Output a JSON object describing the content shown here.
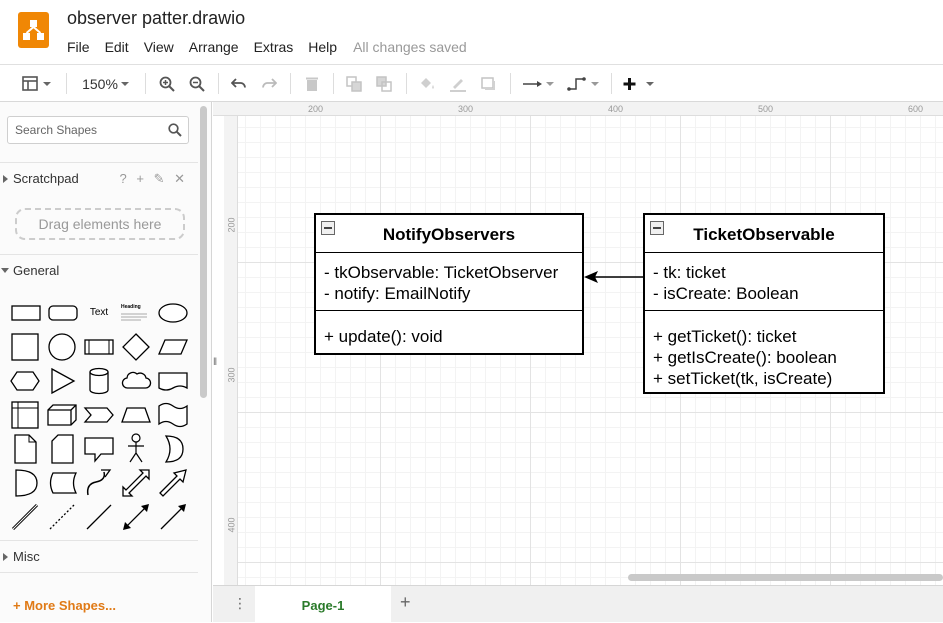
{
  "app": {
    "document_title": "observer patter.drawio",
    "save_status": "All changes saved",
    "menu": [
      "File",
      "Edit",
      "View",
      "Arrange",
      "Extras",
      "Help"
    ]
  },
  "toolbar": {
    "zoom": "150%",
    "icons": [
      "format-panel-icon",
      "zoom-in-icon",
      "zoom-out-icon",
      "undo-icon",
      "redo-icon",
      "delete-icon",
      "to-front-icon",
      "to-back-icon",
      "fill-color-icon",
      "line-color-icon",
      "shadow-icon",
      "connection-icon",
      "waypoints-icon",
      "insert-icon"
    ]
  },
  "sidebar": {
    "search_placeholder": "Search Shapes",
    "scratchpad": {
      "label": "Scratchpad",
      "tools": "? + ✎ ✕",
      "drop_text": "Drag elements here"
    },
    "general_label": "General",
    "shape_text_label": "Text",
    "shape_heading_label": "Heading",
    "misc_label": "Misc",
    "more_shapes": "More Shapes..."
  },
  "rulers": {
    "horizontal": [
      "200",
      "300",
      "400",
      "500",
      "600"
    ],
    "vertical": [
      "200",
      "300",
      "400"
    ]
  },
  "diagram": {
    "classes": [
      {
        "name": "NotifyObservers",
        "attributes": [
          "- tkObservable: TicketObserver",
          "- notify: EmailNotify"
        ],
        "methods": [
          "+ update(): void"
        ]
      },
      {
        "name": "TicketObservable",
        "attributes": [
          "- tk: ticket",
          "- isCreate: Boolean"
        ],
        "methods": [
          "+ getTicket(): ticket",
          "+ getIsCreate(): boolean",
          "+ setTicket(tk, isCreate)"
        ]
      }
    ]
  },
  "pages": {
    "current": "Page-1"
  }
}
